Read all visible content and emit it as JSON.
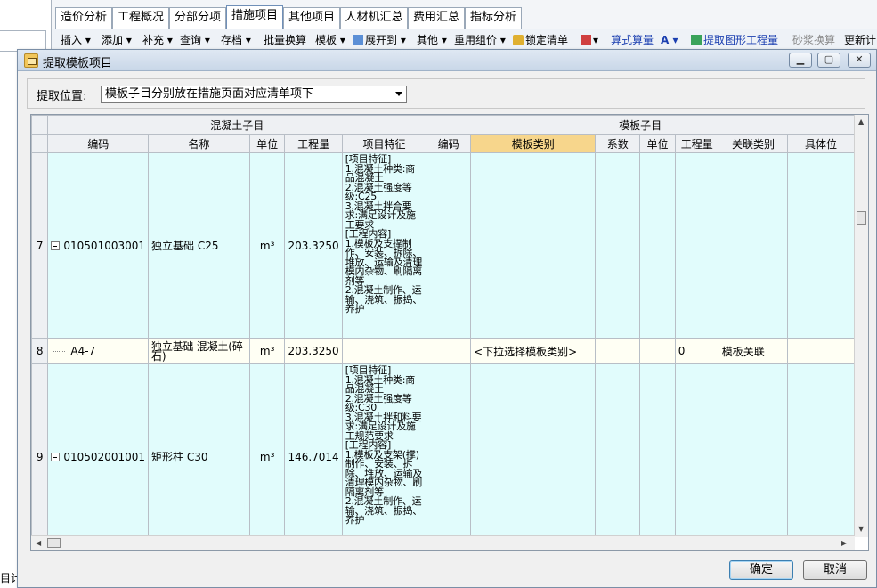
{
  "app": {
    "tabs": [
      "造价分析",
      "工程概况",
      "分部分项",
      "措施项目",
      "其他项目",
      "人材机汇总",
      "费用汇总",
      "指标分析"
    ],
    "active_tab": "措施项目",
    "toolbar": {
      "insert": "插入 ▾",
      "add": "添加 ▾",
      "supplement": "补充 ▾",
      "query": "查询 ▾",
      "save": "存档 ▾",
      "batch_convert": "批量换算",
      "template": "模板 ▾",
      "expand_to": "展开到 ▾",
      "other": "其他 ▾",
      "reuse": "重用组价 ▾",
      "lock": "锁定清单",
      "formula": "算式算量",
      "extract_graphic": "提取图形工程量",
      "mortar_convert": "砂浆换算",
      "update": "更新计"
    },
    "bottom_left_text": "目计"
  },
  "dialog": {
    "title": "提取模板项目",
    "filter_label": "提取位置:",
    "filter_value": "模板子目分别放在措施页面对应清单项下",
    "ok_label": "确定",
    "cancel_label": "取消"
  },
  "grid": {
    "group_headers": {
      "concrete": "混凝土子目",
      "template": "模板子目"
    },
    "headers": {
      "code": "编码",
      "name": "名称",
      "unit": "单位",
      "qty": "工程量",
      "feature": "项目特征",
      "t_code": "编码",
      "t_type": "模板类别",
      "t_coef": "系数",
      "t_unit": "单位",
      "t_qty": "工程量",
      "t_rel": "关联类别",
      "t_pos": "具体位"
    },
    "rows": [
      {
        "idx": "7",
        "code": "010501003001",
        "name": "独立基础 C25",
        "unit": "m³",
        "qty": "203.3250",
        "feature": "[项目特征]\n1.混凝土种类:商品混凝土\n2.混凝土强度等级:C25\n3.混凝土拌合要求:满足设计及施工要求\n[工程内容]\n1.模板及支撑制作、安装、拆除、堆放、运输及清理模内杂物、刷隔离剂等\n2.混凝土制作、运输、浇筑、振捣、养护",
        "t_code": "",
        "t_type": "",
        "t_coef": "",
        "t_unit": "",
        "t_qty": "",
        "t_rel": "",
        "t_pos": ""
      },
      {
        "idx": "8",
        "code": "A4-7",
        "name": "独立基础 混凝土(碎石)",
        "unit": "m³",
        "qty": "203.3250",
        "feature": "",
        "t_code": "",
        "t_type": "<下拉选择模板类别>",
        "t_coef": "",
        "t_unit": "",
        "t_qty": "0",
        "t_rel": "模板关联",
        "t_pos": ""
      },
      {
        "idx": "9",
        "code": "010502001001",
        "name": "矩形柱 C30",
        "unit": "m³",
        "qty": "146.7014",
        "feature": "[项目特征]\n1.混凝土种类:商品混凝土\n2.混凝土强度等级:C30\n3.混凝土拌和料要求:满足设计及施工规范要求\n[工程内容]\n1.模板及支架(撑)制作、安装、拆除、堆放、运输及清理模内杂物、刷隔离剂等\n2.混凝土制作、运输、浇筑、振捣、养护",
        "t_code": "",
        "t_type": "",
        "t_coef": "",
        "t_unit": "",
        "t_qty": "",
        "t_rel": "",
        "t_pos": ""
      }
    ]
  }
}
